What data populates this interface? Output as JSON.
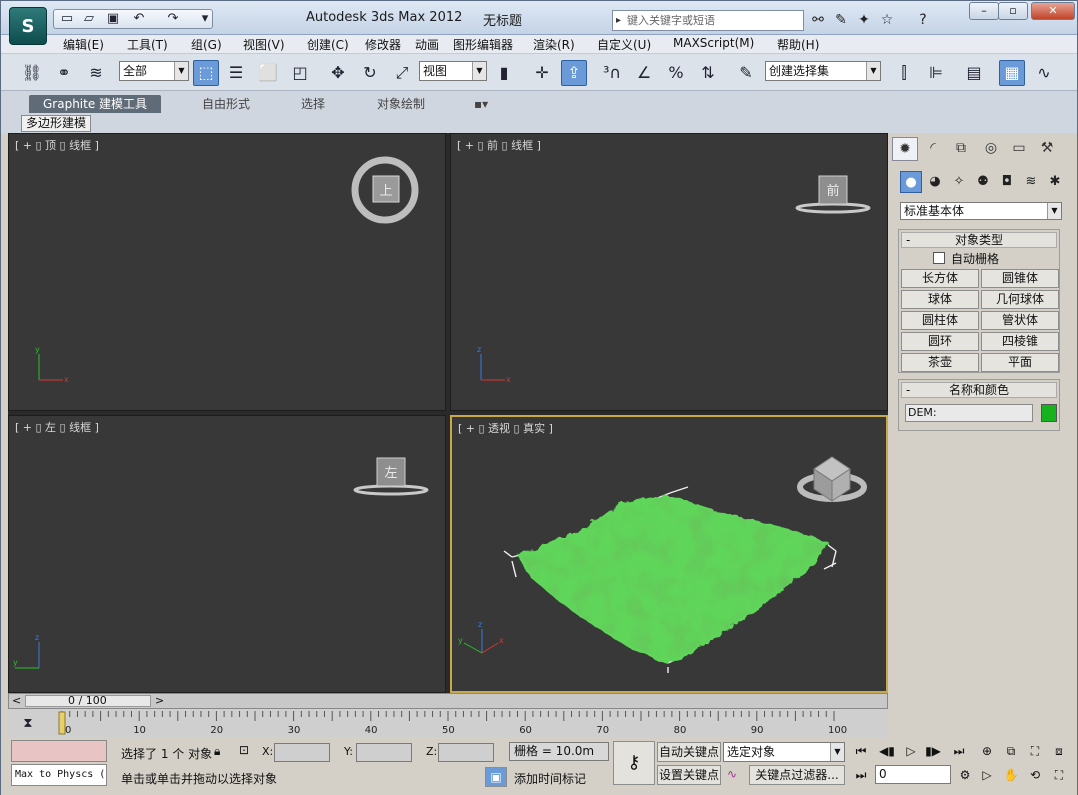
{
  "title": {
    "app": "Autodesk 3ds Max  2012",
    "doc": "无标题",
    "search_placeholder": "键入关键字或短语"
  },
  "menu": [
    "编辑(E)",
    "工具(T)",
    "组(G)",
    "视图(V)",
    "创建(C)",
    "修改器",
    "动画",
    "图形编辑器",
    "渲染(R)",
    "自定义(U)",
    "MAXScript(M)",
    "帮助(H)"
  ],
  "toolbar": {
    "selection_filter": "全部",
    "ref_coord": "视图",
    "named_selection": "创建选择集"
  },
  "ribbon": {
    "tabs": [
      "Graphite 建模工具",
      "自由形式",
      "选择",
      "对象绘制"
    ],
    "subtab": "多边形建模"
  },
  "viewports": {
    "top": {
      "label": "[ + ▯ 顶 ▯ 线框 ]",
      "cube": "上"
    },
    "front": {
      "label": "[ + ▯ 前 ▯ 线框 ]",
      "cube": "前"
    },
    "left": {
      "label": "[ + ▯ 左 ▯ 线框 ]",
      "cube": "左"
    },
    "persp": {
      "label": "[ + ▯ 透视 ▯ 真实 ]"
    }
  },
  "command_panel": {
    "category": "标准基本体",
    "object_type": {
      "title": "对象类型",
      "autogrid": "自动栅格",
      "buttons": [
        "长方体",
        "圆锥体",
        "球体",
        "几何球体",
        "圆柱体",
        "管状体",
        "圆环",
        "四棱锥",
        "茶壶",
        "平面"
      ]
    },
    "name_color": {
      "title": "名称和颜色",
      "name": "DEM:",
      "color": "#17b31f"
    }
  },
  "timeline": {
    "frame": "0 / 100",
    "ticks": [
      "0",
      "10",
      "20",
      "30",
      "40",
      "50",
      "60",
      "70",
      "80",
      "90",
      "100"
    ]
  },
  "status": {
    "script_listener": "Max to Physcs (",
    "selected": "选择了 1 个 对象",
    "prompt": "单击或单击并拖动以选择对象",
    "x_label": "X:",
    "y_label": "Y:",
    "z_label": "Z:",
    "grid": "栅格 = 10.0m",
    "add_time_tag": "添加时间标记",
    "auto_key": "自动关键点",
    "set_key": "设置关键点",
    "key_mode": "选定对象",
    "key_filters": "关键点过滤器...",
    "current_frame": "0"
  },
  "colors": {
    "terrain": "#5ed65a",
    "viewport_bg": "#383838",
    "active_border": "#c8a94a"
  }
}
